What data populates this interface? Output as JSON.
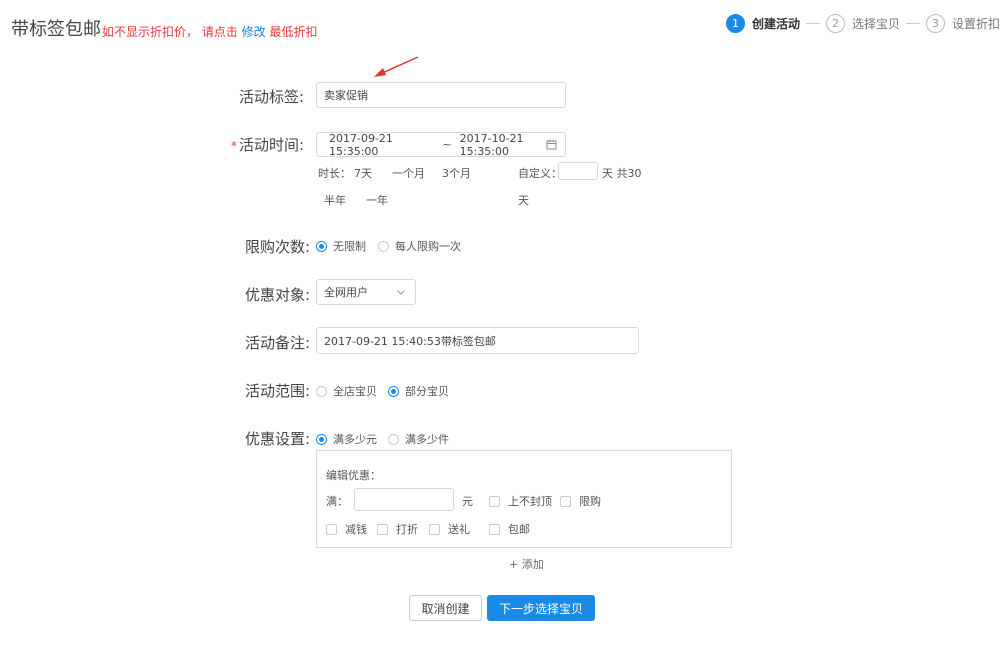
{
  "header": {
    "title": "带标签包邮",
    "hint_prefix": "如不显示折扣价， 请点击",
    "hint_link": "修改",
    "hint_suffix": "最低折扣"
  },
  "steps": [
    {
      "num": "1",
      "label": "创建活动",
      "active": true
    },
    {
      "num": "2",
      "label": "选择宝贝",
      "active": false
    },
    {
      "num": "3",
      "label": "设置折扣",
      "active": false
    }
  ],
  "form": {
    "tag": {
      "label": "活动标签:",
      "value": "卖家促销"
    },
    "time": {
      "label": "活动时间:",
      "required_mark": "*",
      "start": "2017-09-21 15:35:00",
      "sep": "~",
      "end": "2017-10-21 15:35:00",
      "duration_label": "时长：",
      "durations": [
        "7天",
        "一个月",
        "3个月",
        "半年",
        "一年"
      ],
      "custom_label": "自定义：",
      "custom_suffix": "天 共30",
      "custom_suffix2": "天"
    },
    "limit": {
      "label": "限购次数:",
      "options": [
        "无限制",
        "每人限购一次"
      ],
      "selected": 0
    },
    "target": {
      "label": "优惠对象:",
      "value": "全网用户"
    },
    "note": {
      "label": "活动备注:",
      "value": "2017-09-21 15:40:53带标签包邮"
    },
    "scope": {
      "label": "活动范围:",
      "options": [
        "全店宝贝",
        "部分宝贝"
      ],
      "selected": 1
    },
    "discount": {
      "label": "优惠设置:",
      "options": [
        "满多少元",
        "满多少件"
      ],
      "selected": 0,
      "edit_title": "编辑优惠：",
      "full_label": "满：",
      "unit": "元",
      "checks": [
        "上不封顶",
        "限购",
        "减钱",
        "打折",
        "送礼",
        "包邮"
      ],
      "add": "+ 添加"
    }
  },
  "buttons": {
    "cancel": "取消创建",
    "next": "下一步选择宝贝"
  },
  "colors": {
    "primary": "#1b8ae6",
    "hint_red": "#e4393c",
    "link_blue": "#1a7fd9",
    "arrow": "#e03030"
  }
}
